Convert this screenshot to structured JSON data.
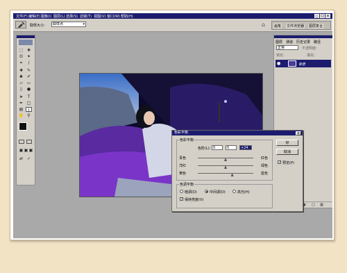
{
  "menu": {
    "items": [
      "文件(F)",
      "编辑(E)",
      "图像(I)",
      "图层(L)",
      "选择(S)",
      "滤镜(T)",
      "视图(V)",
      "窗口(W)",
      "帮助(H)"
    ],
    "min_label": "_",
    "max_label": "□",
    "close_label": "x"
  },
  "options": {
    "sample_size_label": "取样大小:",
    "sample_size_value": "取样点"
  },
  "palette": {
    "tabs": [
      "画笔",
      "文件浏览器",
      "图层复合"
    ],
    "layer_tabs": [
      "图层",
      "通道",
      "历史记录",
      "路径"
    ],
    "blend_mode": "正常",
    "opacity_label": "不透明度:",
    "lock_label": "锁定:",
    "fill_label": "填充:",
    "layer_name": "背景"
  },
  "dialog": {
    "title": "色彩平衡",
    "close_label": "x",
    "balance_group": "色彩平衡",
    "levels_label": "色阶(L):",
    "level1": "0",
    "level2": "0",
    "level3": "+24",
    "rows": [
      {
        "left": "青色",
        "right": "红色",
        "value": 0
      },
      {
        "left": "洋红",
        "right": "绿色",
        "value": 0
      },
      {
        "left": "黄色",
        "right": "蓝色",
        "value": 24
      }
    ],
    "tone_group": "色调平衡",
    "tones": [
      "暗调(D)",
      "中间调(D)",
      "高光(H)"
    ],
    "selected_tone": 1,
    "preserve_label": "保持亮度(V)",
    "preserve_checked": true,
    "ok_label": "好",
    "cancel_label": "取消",
    "preview_label": "预览(P)",
    "preview_checked": true
  }
}
